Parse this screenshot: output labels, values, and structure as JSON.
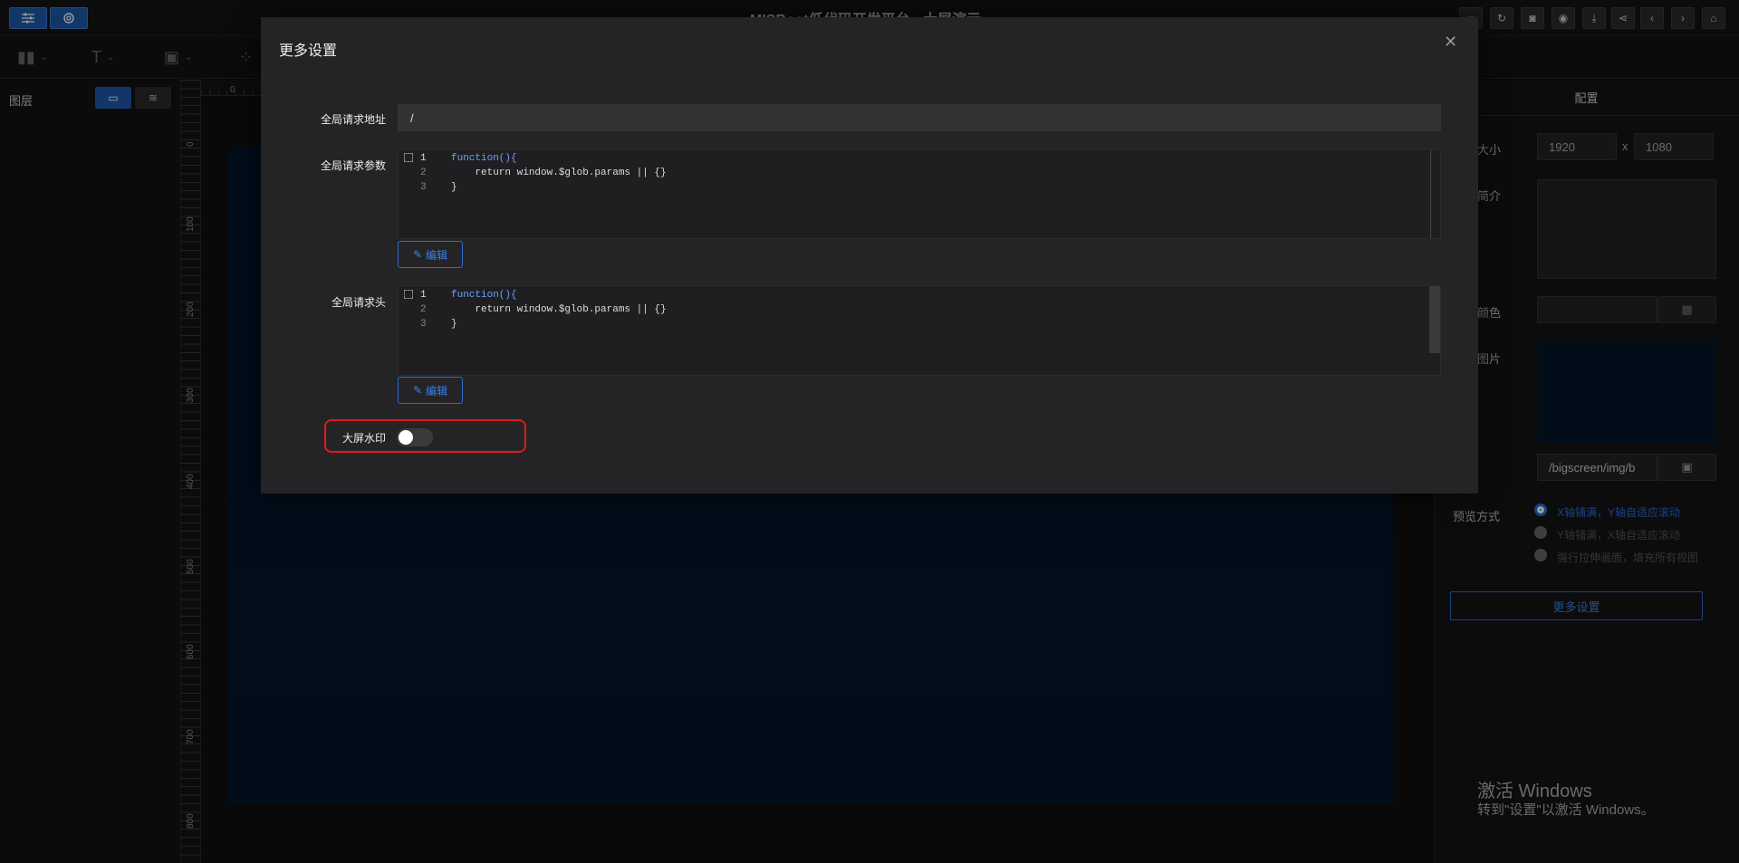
{
  "app": {
    "title": "MISBoot低代码开发平台 - 大屏演示"
  },
  "toolbar": {
    "tools": [
      "bar-chart-icon",
      "text-icon",
      "image-icon",
      "grid-icon"
    ]
  },
  "left_panel": {
    "title": "图层"
  },
  "ruler": {
    "h_zero": "0",
    "v_ticks": [
      "0",
      "100",
      "200",
      "300",
      "400",
      "500",
      "600",
      "700",
      "800"
    ]
  },
  "right_panel": {
    "tab": "配置",
    "size_label": "大小",
    "width": "1920",
    "height": "1080",
    "size_sep": "x",
    "intro_label": "简介",
    "color_label": "颜色",
    "image_label": "图片",
    "image_path": "/bigscreen/img/b",
    "preview_label": "预览方式",
    "preview_options": [
      "X轴铺满，Y轴自适应滚动",
      "Y轴铺满，X轴自适应滚动",
      "强行拉伸画面，填充所有视图"
    ],
    "more_button": "更多设置"
  },
  "modal": {
    "title": "更多设置",
    "url_label": "全局请求地址",
    "url_value": "/",
    "params_label": "全局请求参数",
    "headers_label": "全局请求头",
    "code_lines": [
      "function(){",
      "    return window.$glob.params || {}",
      "}"
    ],
    "line_numbers": [
      "1",
      "2",
      "3"
    ],
    "edit_button": "编辑",
    "watermark_label": "大屏水印",
    "watermark_enabled": false
  },
  "activation": {
    "line1": "激活 Windows",
    "line2": "转到\"设置\"以激活 Windows。"
  },
  "colors": {
    "accent": "#1d6fd6",
    "highlight": "#e01a1a"
  }
}
